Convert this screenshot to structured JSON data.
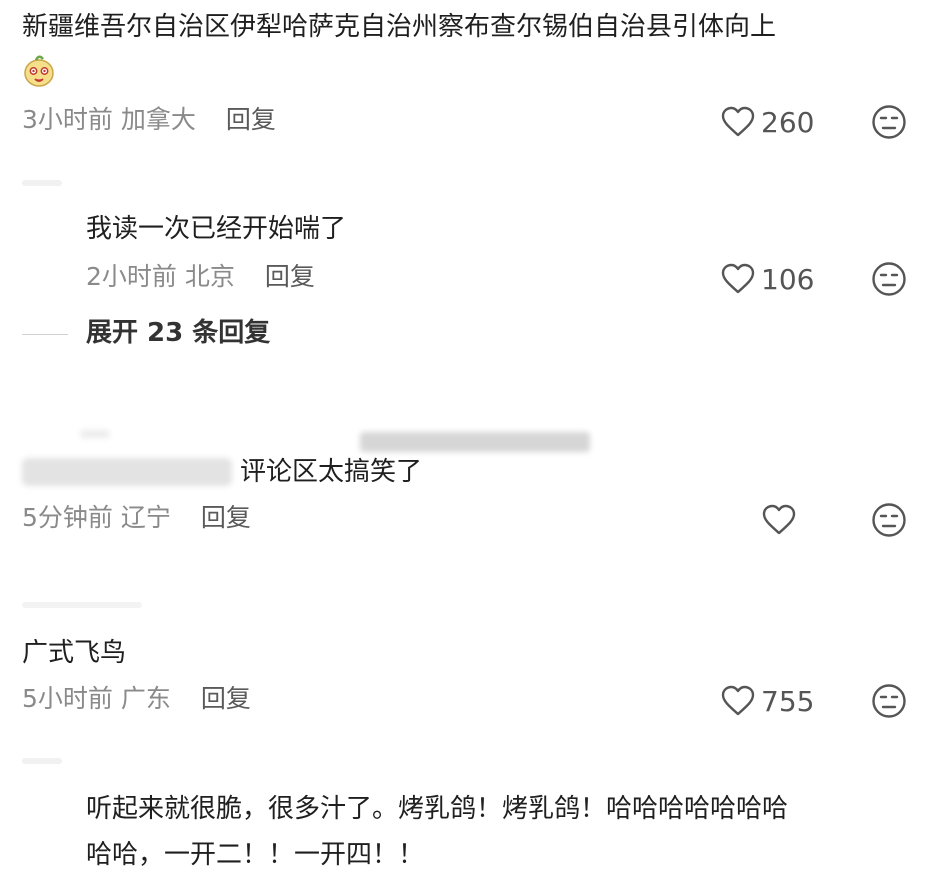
{
  "comments": [
    {
      "text": "新疆维吾尔自治区伊犁哈萨克自治州察布查尔锡伯自治县引体向上",
      "time": "3小时前",
      "location": "加拿大",
      "reply": "回复",
      "likes": "260"
    },
    {
      "text": "我读一次已经开始喘了",
      "time": "2小时前",
      "location": "北京",
      "reply": "回复",
      "likes": "106",
      "expand": "展开 23 条回复"
    },
    {
      "text": "评论区太搞笑了",
      "time": "5分钟前",
      "location": "辽宁",
      "reply": "回复",
      "likes": ""
    },
    {
      "author": "广式飞鸟",
      "time": "5小时前",
      "location": "广东",
      "reply": "回复",
      "likes": "755"
    },
    {
      "text_line1": "听起来就很脆，很多汁了。烤乳鸽！烤乳鸽！哈哈哈哈哈哈哈",
      "text_line2": "哈哈，一开二！！一开四！！"
    }
  ],
  "icons": {
    "heart": "heart-outline",
    "dislike": "meh-face",
    "emoji": "sticker-emoji"
  },
  "colors": {
    "text": "#1f1f1f",
    "meta": "#8a8a8a",
    "icon": "#555555"
  }
}
